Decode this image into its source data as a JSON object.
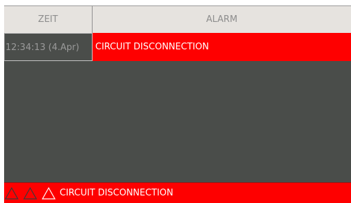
{
  "table": {
    "headers": {
      "time": "ZEIT",
      "alarm": "ALARM"
    },
    "rows": [
      {
        "time": "12:34:13 (4.Apr)",
        "alarm": "CIRCUIT DISCONNECTION"
      }
    ]
  },
  "footer": {
    "message": "CIRCUIT DISCONNECTION",
    "icons": [
      "warning-triangle-icon",
      "warning-triangle-icon",
      "warning-triangle-icon"
    ]
  },
  "colors": {
    "alarm_red": "#fe0000",
    "panel_gray": "#4a4d4a",
    "header_bg": "#e6e3df"
  }
}
